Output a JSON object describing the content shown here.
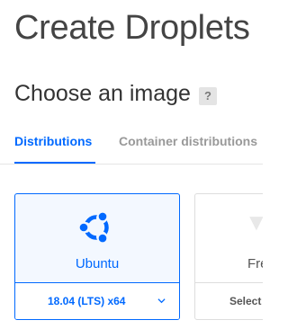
{
  "header": {
    "title": "Create Droplets"
  },
  "section": {
    "title": "Choose an image",
    "help": "?"
  },
  "tabs": [
    {
      "label": "Distributions",
      "active": true
    },
    {
      "label": "Container distributions",
      "active": false
    }
  ],
  "cards": [
    {
      "name": "Ubuntu",
      "version": "18.04 (LTS) x64",
      "selected": true,
      "icon": "ubuntu-icon"
    },
    {
      "name": "Fre",
      "version": "Select",
      "selected": false,
      "icon": "freebsd-icon"
    }
  ],
  "colors": {
    "accent": "#0069ff",
    "selected_bg": "#f3f8ff",
    "tab_inactive": "#999999"
  }
}
